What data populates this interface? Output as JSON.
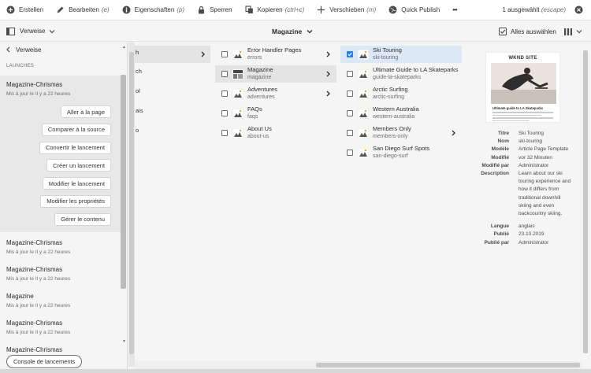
{
  "toolbar": {
    "create": "Erstellen",
    "edit": "Bearbeiten",
    "edit_sc": "(e)",
    "props": "Eigenschaften",
    "props_sc": "(p)",
    "lock": "Sperren",
    "copy": "Kopieren",
    "copy_sc": "(ctrl+c)",
    "move": "Verschieben",
    "move_sc": "(m)",
    "publish": "Quick Publish",
    "more": "•••",
    "selected": "1 ausgewählt",
    "selected_sc": "(escape)"
  },
  "secbar": {
    "rail_label": "Verweise",
    "title": "Magazine",
    "select_all": "Alles auswählen"
  },
  "rail": {
    "back_label": "Verweise",
    "caption": "LAUNCHES",
    "active": {
      "title": "Magazine-Chrismas",
      "sub": "Mis à jour le Il y a 22 heures"
    },
    "actions": [
      "Aller à la page",
      "Comparer à la source",
      "Convertir le lancement",
      "Créer un lancement",
      "Modifier le lancement",
      "Modifier les propriétés",
      "Gérer le contenu"
    ],
    "items": [
      {
        "title": "Magazine-Chrismas",
        "sub": "Mis à jour le Il y a 22 heures"
      },
      {
        "title": "Magazine-Chrismas",
        "sub": "Mis à jour le Il y a 22 heures"
      },
      {
        "title": "Magazine",
        "sub": "Mis à jour le Il y a 22 heures"
      },
      {
        "title": "Magazine-Chrismas",
        "sub": "Mis à jour le Il y a 22 heures"
      },
      {
        "title": "Magazine-Chrismas",
        "sub": ""
      }
    ],
    "console": "Console de lancements"
  },
  "col0": {
    "fragments": [
      "h",
      "ch",
      "ol",
      "ais",
      "o"
    ]
  },
  "col1": {
    "items": [
      {
        "title": "Error Handler Pages",
        "name": "errors"
      },
      {
        "title": "Magazine",
        "name": "magazine"
      },
      {
        "title": "Adventures",
        "name": "adventures"
      },
      {
        "title": "FAQs",
        "name": "faqs"
      },
      {
        "title": "About Us",
        "name": "about-us"
      }
    ]
  },
  "col2": {
    "items": [
      {
        "title": "Ski Touring",
        "name": "ski-touring"
      },
      {
        "title": "Ultimate Guide to LA Skateparks",
        "name": "guide-la-skateparks"
      },
      {
        "title": "Arctic Surfing",
        "name": "arctic-surfing"
      },
      {
        "title": "Western Australia",
        "name": "western-australia"
      },
      {
        "title": "Members Only",
        "name": "members-only"
      },
      {
        "title": "San Diego Surf Spots",
        "name": "san-diego-surf"
      }
    ]
  },
  "preview": {
    "brand": "WKND SITE",
    "headline": "Ultimate guide to LA Skateparks"
  },
  "meta": [
    {
      "k": "Titre",
      "v": "Ski Touring"
    },
    {
      "k": "Nom",
      "v": "ski-touring"
    },
    {
      "k": "Modèle",
      "v": "Article Page Template"
    },
    {
      "k": "Modifié",
      "v": "vor 32 Minuten"
    },
    {
      "k": "Modifié par",
      "v": "Administrator"
    },
    {
      "k": "Description",
      "v": "Learn about our ski touring experience and how it differs from traditional downhill skiing and even backcountry skiing."
    },
    {
      "k": "Langue",
      "v": "anglais"
    },
    {
      "k": "Publié",
      "v": "23.10.2019"
    },
    {
      "k": "Publié par",
      "v": "Administrator"
    }
  ],
  "colors": {
    "accent": "#2680eb",
    "selected_row": "#dde8f7",
    "active_row": "#e4e4e4"
  }
}
